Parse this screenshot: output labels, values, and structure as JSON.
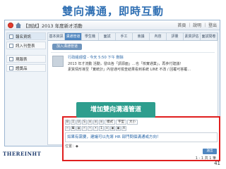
{
  "slide": {
    "title": "雙向溝通，即時互動",
    "page_number": "41"
  },
  "app": {
    "title": "【測試】2013 年度新才活動",
    "header_right": "首頁 ｜ 說明 ｜ 登出",
    "accent_color": "#4f86c0"
  },
  "sidebar": {
    "items": [
      {
        "label": "報名資訊",
        "icon": "info-icon"
      },
      {
        "label": "訊入刊登表",
        "icon": "form-icon"
      },
      {
        "label": "現報表",
        "icon": "report-icon"
      },
      {
        "label": "證獎品",
        "icon": "prize-icon"
      }
    ]
  },
  "tabs": [
    "基本資訊",
    "溝通管道",
    "學生機",
    "面試",
    "手工",
    "會議",
    "內容",
    "評量",
    "素質評估",
    "面試問卷"
  ],
  "subtab_label": "加入溝通管道",
  "post": {
    "meta": "行政組經理 - 今天 5:50 下午 刪除",
    "lines": [
      "2013 年才流動 活動，發出各「調源面」…也「核實通業」，再參付建議！",
      "素質情形導至「實統計」內容通可檢查結果看到系統 LINE 不改 / 回覆可答覆…"
    ]
  },
  "callout": "增加雙向溝通管道",
  "editor": {
    "font_select": "字型",
    "size_select": "大小",
    "style_select": "樣式",
    "text": "如果有需要，建議可以先將 HR 部門問個溝通或方向！",
    "footer": "位置：◆",
    "submit_label": "送出",
    "pager": "1 - 1 共 1 筆"
  },
  "brand": "THEREINHT"
}
